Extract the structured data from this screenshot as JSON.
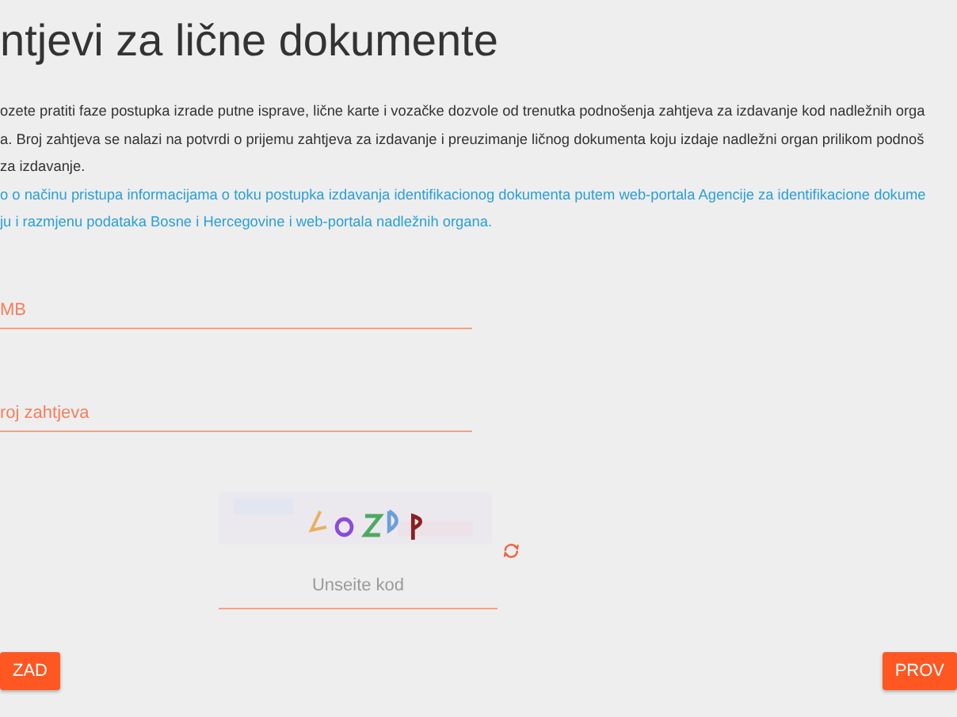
{
  "title": "ntjevi za lične dokumente",
  "intro": [
    "ozete pratiti faze postupka izrade putne isprave, lične karte i vozačke dozvole od trenutka podnošenja zahtjeva za izdavanje kod nadležnih orga",
    "a. Broj zahtjeva se nalazi na potvrdi o prijemu zahtjeva za izdavanje i preuzimanje ličnog dokumenta koju izdaje nadležni organ prilikom podnoš",
    "za izdavanje."
  ],
  "info_link": [
    "o o načinu pristupa informacijama o toku postupka izdavanja identifikacionog dokumenta putem web-portala Agencije za identifikacione dokume",
    "ju i razmjenu podataka Bosne i Hercegovine i web-portala nadležnih organa."
  ],
  "fields": [
    {
      "placeholder": "MB"
    },
    {
      "placeholder": "roj zahtjeva"
    }
  ],
  "captcha": {
    "kind": "picture",
    "placeholder": "Unseite kod"
  },
  "buttons": [
    {
      "label": "ZAD"
    },
    {
      "label": "PROV"
    }
  ]
}
